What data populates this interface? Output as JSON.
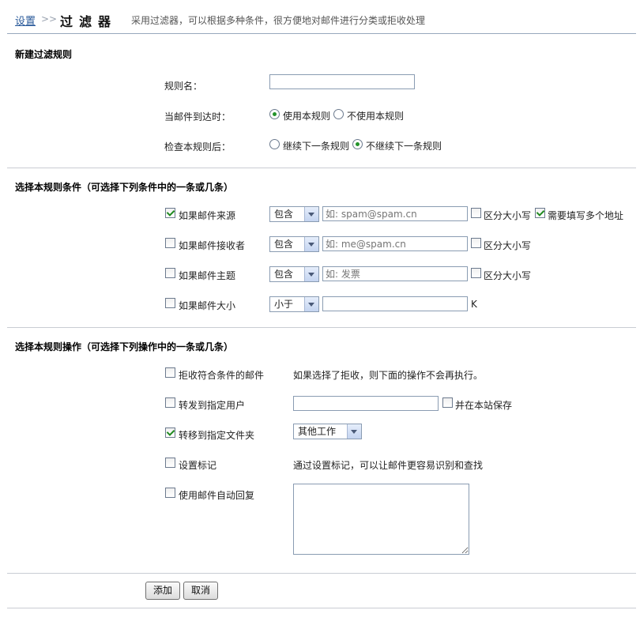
{
  "header": {
    "breadcrumb_link": "设置",
    "separator": ">>",
    "title": "过滤器",
    "description": "采用过滤器，可以根据多种条件，很方便地对邮件进行分类或拒收处理"
  },
  "new_rule": {
    "section_title": "新建过滤规则",
    "rule_name_label": "规则名：",
    "rule_name_value": "",
    "arrival_label": "当邮件到达时：",
    "arrival_options": [
      "使用本规则",
      "不使用本规则"
    ],
    "arrival_selected": "使用本规则",
    "after_check_label": "检查本规则后：",
    "after_check_options": [
      "继续下一条规则",
      "不继续下一条规则"
    ],
    "after_check_selected": "不继续下一条规则"
  },
  "conditions": {
    "section_title": "选择本规则条件（可选择下列条件中的一条或几条）",
    "rows": [
      {
        "label": "如果邮件来源",
        "checked": true,
        "operator": "包含",
        "placeholder": "如: spam@spam.cn",
        "case_label": "区分大小写",
        "case_checked": false,
        "extra_label": "需要填写多个地址",
        "extra_checked": true
      },
      {
        "label": "如果邮件接收者",
        "checked": false,
        "operator": "包含",
        "placeholder": "如: me@spam.cn",
        "case_label": "区分大小写",
        "case_checked": false
      },
      {
        "label": "如果邮件主题",
        "checked": false,
        "operator": "包含",
        "placeholder": "如: 发票",
        "case_label": "区分大小写",
        "case_checked": false
      },
      {
        "label": "如果邮件大小",
        "checked": false,
        "operator": "小于",
        "placeholder": "",
        "unit": "K"
      }
    ]
  },
  "actions": {
    "section_title": "选择本规则操作（可选择下列操作中的一条或几条）",
    "reject": {
      "label": "拒收符合条件的邮件",
      "checked": false,
      "note": "如果选择了拒收，则下面的操作不会再执行。"
    },
    "forward": {
      "label": "转发到指定用户",
      "checked": false,
      "value": "",
      "keep_label": "并在本站保存",
      "keep_checked": false
    },
    "move": {
      "label": "转移到指定文件夹",
      "checked": true,
      "folder": "其他工作"
    },
    "flag": {
      "label": "设置标记",
      "checked": false,
      "note": "通过设置标记，可以让邮件更容易识别和查找"
    },
    "autoreply": {
      "label": "使用邮件自动回复",
      "checked": false,
      "text": ""
    }
  },
  "buttons": {
    "add": "添加",
    "cancel": "取消"
  }
}
